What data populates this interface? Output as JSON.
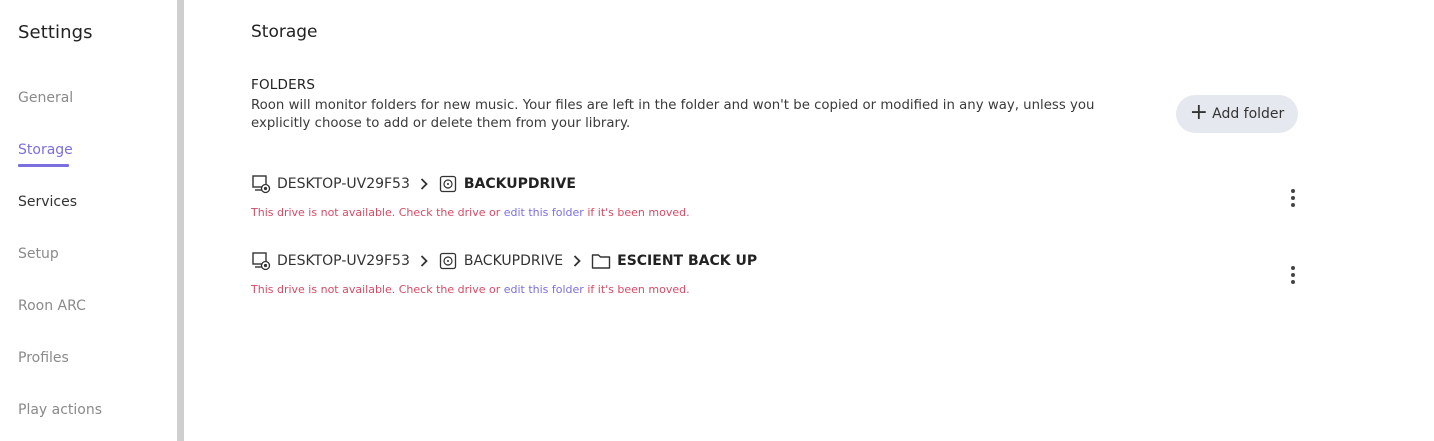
{
  "sidebar": {
    "title": "Settings",
    "items": [
      {
        "label": "General",
        "state": "inactive"
      },
      {
        "label": "Storage",
        "state": "active"
      },
      {
        "label": "Services",
        "state": "dark"
      },
      {
        "label": "Setup",
        "state": "inactive"
      },
      {
        "label": "Roon ARC",
        "state": "inactive"
      },
      {
        "label": "Profiles",
        "state": "inactive"
      },
      {
        "label": "Play actions",
        "state": "inactive"
      }
    ]
  },
  "main": {
    "title": "Storage",
    "section_heading": "FOLDERS",
    "section_description": "Roon will monitor folders for new music. Your files are left in the folder and won't be copied or modified in any way, unless you explicitly choose to add or delete them from your library.",
    "add_folder_label": "Add folder",
    "folders": [
      {
        "path": [
          {
            "icon": "network-computer-icon",
            "label": "DESKTOP-UV29F53",
            "bold": false
          },
          {
            "icon": "drive-icon",
            "label": "BACKUPDRIVE",
            "bold": true
          }
        ],
        "error_prefix": "This drive is not available. Check the drive or ",
        "error_link": "edit this folder",
        "error_suffix": " if it's been moved."
      },
      {
        "path": [
          {
            "icon": "network-computer-icon",
            "label": "DESKTOP-UV29F53",
            "bold": false
          },
          {
            "icon": "drive-icon",
            "label": "BACKUPDRIVE",
            "bold": false
          },
          {
            "icon": "folder-icon",
            "label": "ESCIENT BACK UP",
            "bold": true
          }
        ],
        "error_prefix": "This drive is not available. Check the drive or ",
        "error_link": "edit this folder",
        "error_suffix": " if it's been moved."
      }
    ]
  },
  "colors": {
    "accent": "#7b6fe0",
    "error": "#d84a63",
    "button_bg": "#e6e8f0"
  }
}
